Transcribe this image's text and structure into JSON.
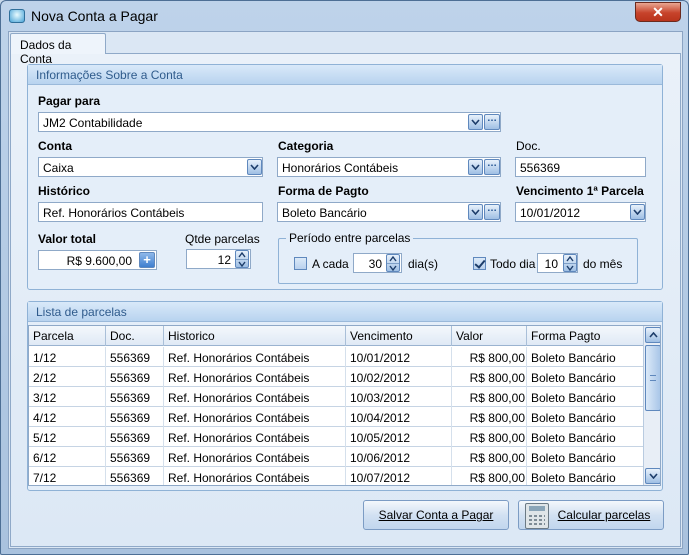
{
  "window": {
    "title": "Nova Conta a Pagar",
    "close_glyph": "✕"
  },
  "tabs": [
    {
      "label": "Dados da Conta"
    }
  ],
  "info_group": {
    "header": "Informações Sobre a Conta",
    "pagar_para": {
      "label": "Pagar para",
      "value": "JM2 Contabilidade"
    },
    "conta": {
      "label": "Conta",
      "value": "Caixa"
    },
    "categoria": {
      "label": "Categoria",
      "value": "Honorários Contábeis"
    },
    "doc": {
      "label": "Doc.",
      "value": "556369"
    },
    "historico": {
      "label": "Histórico",
      "value": "Ref. Honorários Contábeis"
    },
    "forma_pagto": {
      "label": "Forma de Pagto",
      "value": "Boleto Bancário"
    },
    "vencimento": {
      "label": "Vencimento 1ª Parcela",
      "value": "10/01/2012"
    },
    "valor_total": {
      "label": "Valor total",
      "value": "R$ 9.600,00"
    },
    "qtde_parcelas": {
      "label": "Qtde parcelas",
      "value": "12"
    },
    "periodo": {
      "legend": "Período entre parcelas",
      "a_cada": {
        "label": "A cada",
        "checked": false,
        "value": "30",
        "unit": "dia(s)"
      },
      "todo_dia": {
        "label": "Todo dia",
        "checked": true,
        "value": "10",
        "unit": "do mês"
      }
    }
  },
  "list_group": {
    "header": "Lista de parcelas",
    "columns": [
      "Parcela",
      "Doc.",
      "Historico",
      "Vencimento",
      "Valor",
      "Forma Pagto"
    ],
    "rows": [
      [
        "1/12",
        "556369",
        "Ref. Honorários Contábeis",
        "10/01/2012",
        "R$ 800,00",
        "Boleto Bancário"
      ],
      [
        "2/12",
        "556369",
        "Ref. Honorários Contábeis",
        "10/02/2012",
        "R$ 800,00",
        "Boleto Bancário"
      ],
      [
        "3/12",
        "556369",
        "Ref. Honorários Contábeis",
        "10/03/2012",
        "R$ 800,00",
        "Boleto Bancário"
      ],
      [
        "4/12",
        "556369",
        "Ref. Honorários Contábeis",
        "10/04/2012",
        "R$ 800,00",
        "Boleto Bancário"
      ],
      [
        "5/12",
        "556369",
        "Ref. Honorários Contábeis",
        "10/05/2012",
        "R$ 800,00",
        "Boleto Bancário"
      ],
      [
        "6/12",
        "556369",
        "Ref. Honorários Contábeis",
        "10/06/2012",
        "R$ 800,00",
        "Boleto Bancário"
      ],
      [
        "7/12",
        "556369",
        "Ref. Honorários Contábeis",
        "10/07/2012",
        "R$ 800,00",
        "Boleto Bancário"
      ]
    ]
  },
  "buttons": {
    "save": "Salvar Conta a Pagar",
    "calc": "Calcular parcelas"
  },
  "icons": {
    "dropdown": "chevron-down-icon",
    "lookup": "ellipsis-icon",
    "add": "plus-icon",
    "calculator": "calculator-icon",
    "spin": "spin-arrows-icon"
  }
}
